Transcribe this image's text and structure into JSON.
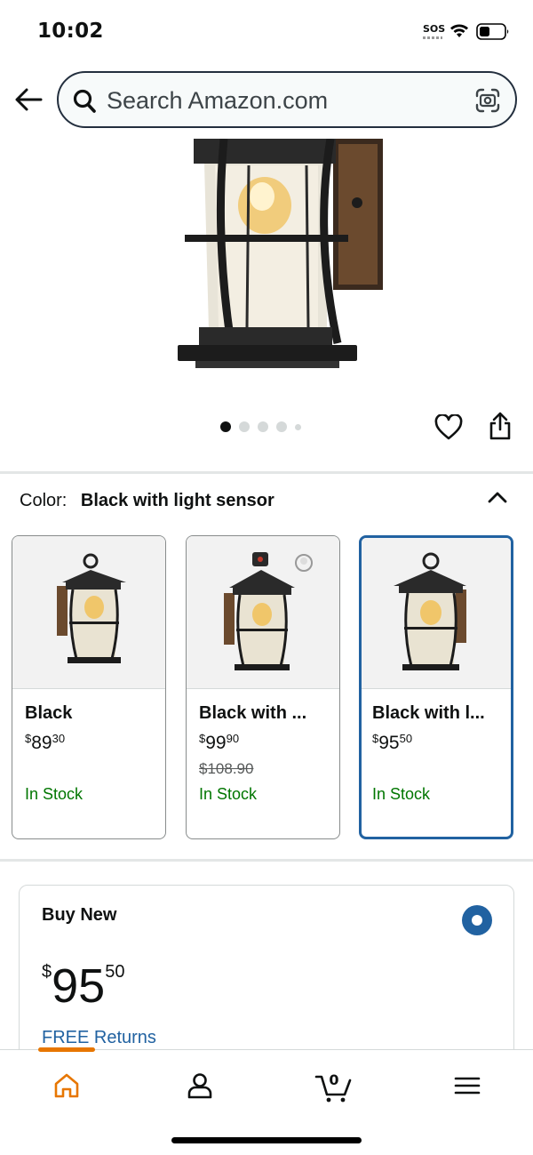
{
  "status_bar": {
    "time": "10:02",
    "sos": "SOS"
  },
  "search": {
    "placeholder": "Search Amazon.com"
  },
  "carousel": {
    "total": 5,
    "active": 0
  },
  "color": {
    "label": "Color:",
    "value": "Black with light sensor"
  },
  "variants": [
    {
      "name": "Black",
      "price_whole": "89",
      "price_fraction": "30",
      "currency": "$",
      "list_price": "",
      "stock": "In Stock",
      "selected": false
    },
    {
      "name": "Black with ...",
      "price_whole": "99",
      "price_fraction": "90",
      "currency": "$",
      "list_price": "$108.90",
      "stock": "In Stock",
      "selected": false
    },
    {
      "name": "Black with l...",
      "price_whole": "95",
      "price_fraction": "50",
      "currency": "$",
      "list_price": "",
      "stock": "In Stock",
      "selected": true
    }
  ],
  "buy_box": {
    "title": "Buy New",
    "currency": "$",
    "price_whole": "95",
    "price_fraction": "50",
    "returns": "FREE Returns"
  },
  "bottom_nav": {
    "cart_count": "0",
    "items": [
      "home-icon",
      "account-icon",
      "cart-icon",
      "menu-icon"
    ]
  },
  "colors": {
    "accent_blue": "#2162a1",
    "stock_green": "#007600",
    "nav_orange": "#e77600"
  }
}
